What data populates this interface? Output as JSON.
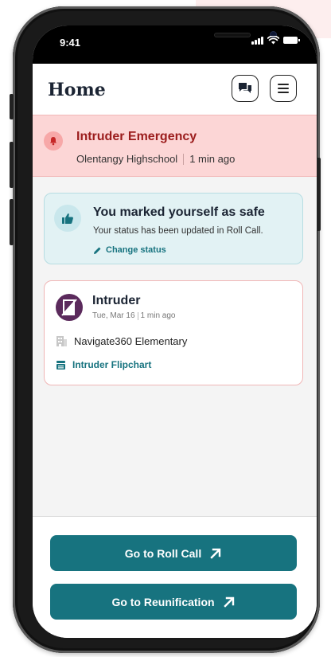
{
  "status_bar": {
    "time": "9:41"
  },
  "header": {
    "title": "Home"
  },
  "alert": {
    "title": "Intruder Emergency",
    "location": "Olentangy Highschool",
    "time_ago": "1 min ago",
    "color": "#9b1c1c"
  },
  "safe_card": {
    "title": "You marked yourself as safe",
    "subtitle": "Your status has been updated in Roll Call.",
    "change_label": "Change status"
  },
  "event_card": {
    "title": "Intruder",
    "date": "Tue, Mar 16",
    "time_ago": "1 min ago",
    "building": "Navigate360 Elementary",
    "flipchart_label": "Intruder Flipchart"
  },
  "footer": {
    "roll_call_label": "Go to Roll Call",
    "reunification_label": "Go to Reunification"
  },
  "colors": {
    "accent": "#17737f",
    "alert_bg": "#fcd6d6",
    "safe_bg": "#e2f2f4"
  }
}
